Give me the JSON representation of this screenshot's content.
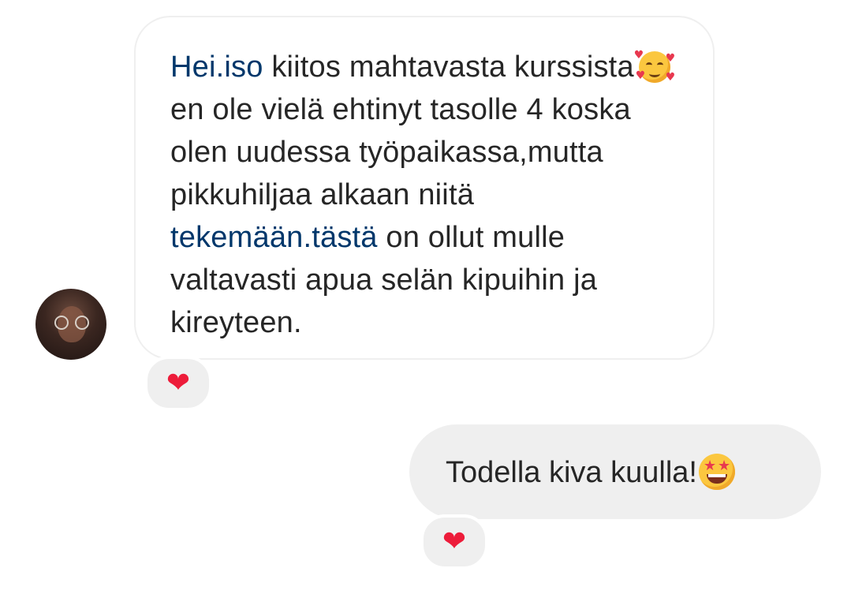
{
  "conversation": {
    "incoming": {
      "avatar_icon": "user-avatar",
      "segments": [
        {
          "text": "Hei.iso",
          "link": true
        },
        {
          "text": " kiitos mahtavasta kurssista",
          "link": false
        },
        {
          "emoji": "smiling-face-with-hearts"
        },
        {
          "text": "en ole vielä ehtinyt tasolle 4 koska olen uudessa työpaikassa,mutta pikkuhiljaa alkaan niitä ",
          "link": false
        },
        {
          "text": "tekemään.tästä",
          "link": true
        },
        {
          "text": " on ollut mulle valtavasti apua selän kipuihin ja kireyteen.",
          "link": false
        }
      ],
      "reaction": "❤"
    },
    "outgoing": {
      "text": "Todella kiva kuulla!",
      "emoji": "star-struck",
      "reaction": "❤"
    }
  },
  "colors": {
    "link": "#00376b",
    "text": "#262626",
    "outgoing_bubble": "#efefef",
    "incoming_border": "#efefef",
    "heart": "#ed1c3a"
  }
}
